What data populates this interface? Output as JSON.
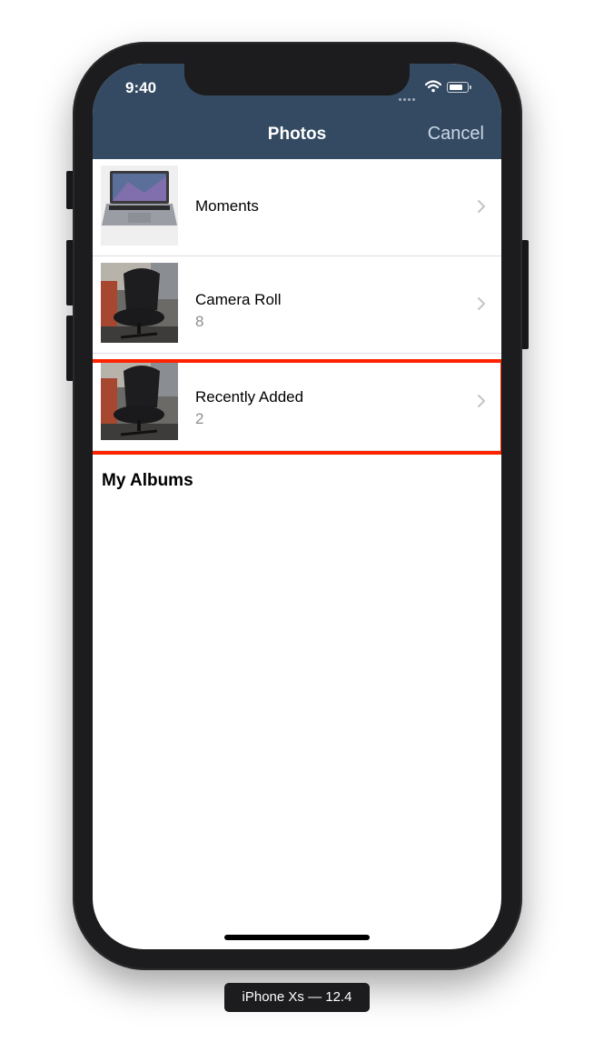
{
  "status_bar": {
    "time": "9:40"
  },
  "nav": {
    "title": "Photos",
    "cancel_label": "Cancel"
  },
  "albums": [
    {
      "title": "Moments",
      "count": ""
    },
    {
      "title": "Camera Roll",
      "count": "8"
    },
    {
      "title": "Recently Added",
      "count": "2"
    }
  ],
  "section": {
    "my_albums": "My Albums"
  },
  "device": {
    "label": "iPhone Xs — 12.4"
  },
  "colors": {
    "nav_bg": "#344a62",
    "highlight": "#ff2200",
    "secondary_text": "#8e8e93"
  },
  "icons": {
    "row_accessory": "chevron-right-icon",
    "wifi": "wifi-icon",
    "battery": "battery-icon"
  }
}
